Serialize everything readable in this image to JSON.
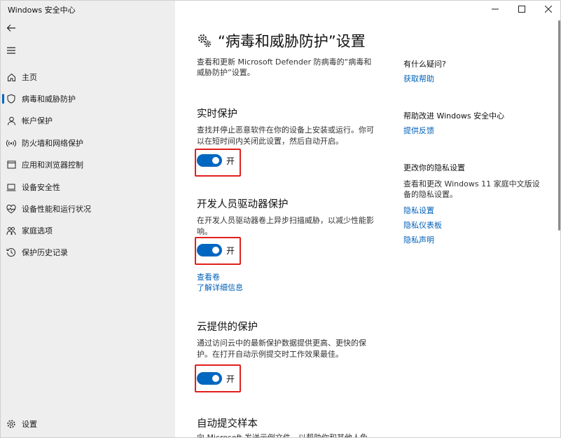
{
  "app": {
    "title": "Windows 安全中心"
  },
  "nav": {
    "items": [
      {
        "label": "主页"
      },
      {
        "label": "病毒和威胁防护"
      },
      {
        "label": "帐户保护"
      },
      {
        "label": "防火墙和网络保护"
      },
      {
        "label": "应用和浏览器控制"
      },
      {
        "label": "设备安全性"
      },
      {
        "label": "设备性能和运行状况"
      },
      {
        "label": "家庭选项"
      },
      {
        "label": "保护历史记录"
      }
    ],
    "settings": "设置"
  },
  "page": {
    "title": "“病毒和威胁防护”设置",
    "intro": "查看和更新 Microsoft Defender 防病毒的“病毒和威胁防护”设置。"
  },
  "sections": {
    "realtime": {
      "title": "实时保护",
      "desc": "查找并停止恶意软件在你的设备上安装或运行。你可以在短时间内关闭此设置，然后自动开启。",
      "toggle": "开"
    },
    "devdrive": {
      "title": "开发人员驱动器保护",
      "desc": "在开发人员驱动器卷上异步扫描威胁，以减少性能影响。",
      "toggle": "开",
      "link1": "查看卷",
      "link2": "了解详细信息"
    },
    "cloud": {
      "title": "云提供的保护",
      "desc": "通过访问云中的最新保护数据提供更高、更快的保护。在打开自动示例提交时工作效果最佳。",
      "toggle": "开"
    },
    "sample": {
      "title": "自动提交样本",
      "desc": "向 Microsoft 发送示例文件，以帮助你和其他人免"
    }
  },
  "side": {
    "question": "有什么疑问?",
    "help": "获取帮助",
    "improve": "帮助改进 Windows 安全中心",
    "feedback": "提供反馈",
    "privacy_title": "更改你的隐私设置",
    "privacy_desc": "查看和更改 Windows 11 家庭中文版设备的隐私设置。",
    "privacy_settings": "隐私设置",
    "privacy_dashboard": "隐私仪表板",
    "privacy_statement": "隐私声明"
  },
  "colors": {
    "accent": "#0067c0",
    "highlight": "#e0201c",
    "sidebar_bg": "#eeeeee",
    "link": "#0060b8"
  }
}
